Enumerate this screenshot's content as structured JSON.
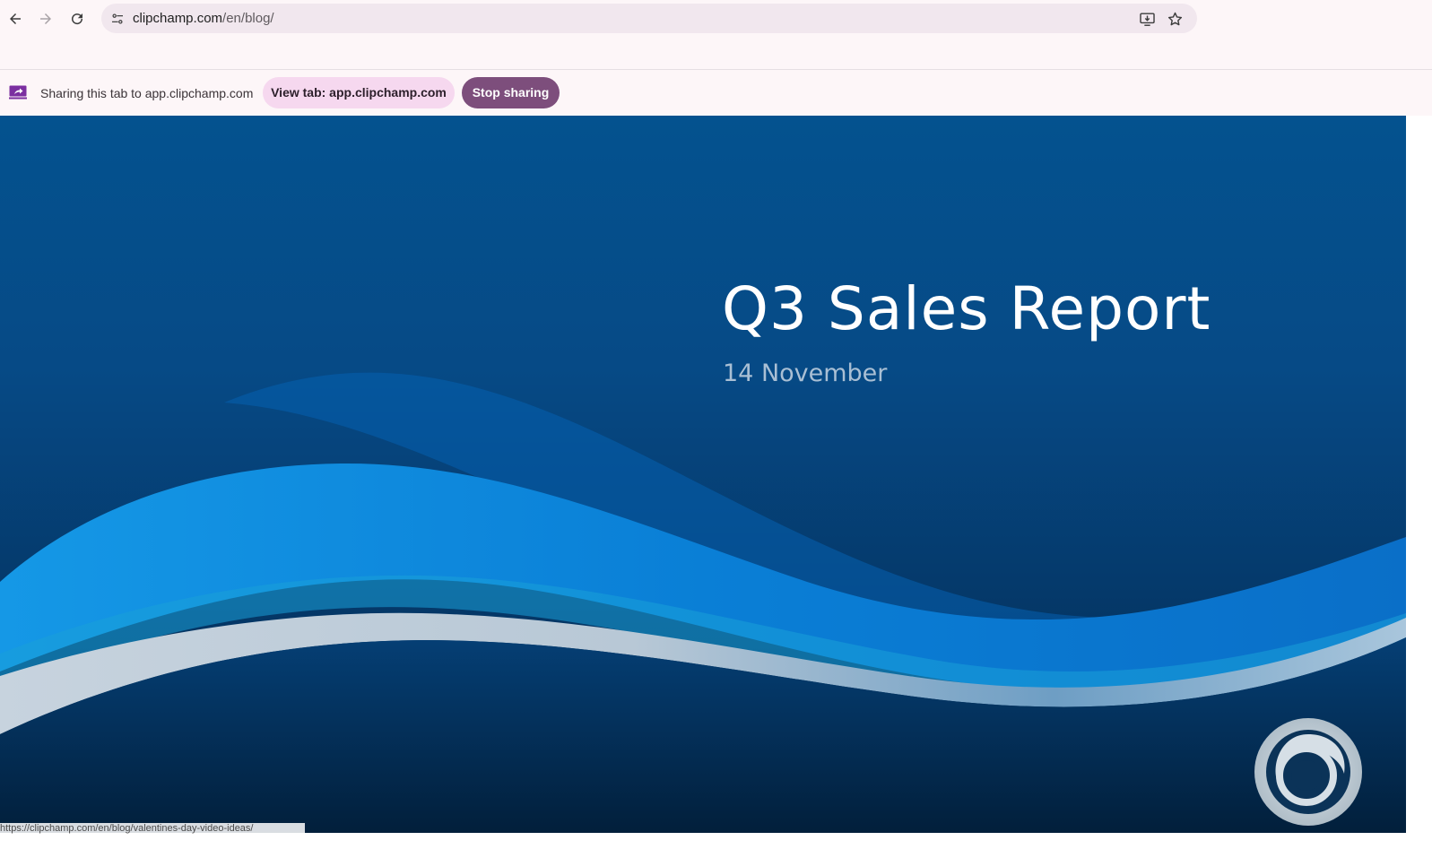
{
  "browser": {
    "url_host": "clipchamp.com",
    "url_path": "/en/blog/",
    "icons": {
      "back": "arrow-left-icon",
      "forward": "arrow-right-icon",
      "reload": "reload-icon",
      "site_info": "tune-icon",
      "install": "install-app-icon",
      "bookmark": "star-icon"
    }
  },
  "sharing_bar": {
    "message": "Sharing this tab to app.clipchamp.com",
    "view_tab_label": "View tab: app.clipchamp.com",
    "stop_label": "Stop sharing",
    "icon": "screen-share-icon"
  },
  "slide": {
    "title": "Q3 Sales Report",
    "date": "14 November",
    "logo": "circular-logo"
  },
  "status_bar": {
    "link_preview": "https://clipchamp.com/en/blog/valentines-day-video-ideas/"
  },
  "colors": {
    "stop_button": "#7d4e7c",
    "view_button": "#f6d8ef",
    "slide_bg": "#064a86",
    "wave_light": "#0a8ad8"
  }
}
